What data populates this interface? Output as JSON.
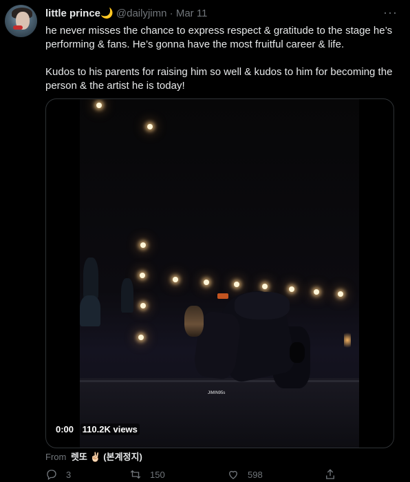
{
  "tweet": {
    "display_name": "little prince",
    "name_emoji": "🌙",
    "handle": "@dailyjimn",
    "separator": "·",
    "date": "Mar 11",
    "more_icon": "more-horizontal-icon",
    "paragraphs": [
      "he never misses the chance to express respect & gratitude to the stage he’s performing & fans. He’s gonna have the most fruitful career & life.",
      "Kudos to his parents for raising him so well & kudos to him for becoming the person & the artist he is today!"
    ],
    "video": {
      "time": "0:00",
      "views": "110.2K views",
      "watermark": "JIMIN95s"
    },
    "source": {
      "from_label": "From",
      "source_name": "렛또 ✌🏻 (본계정지)"
    },
    "actions": {
      "reply_count": "3",
      "retweet_count": "150",
      "like_count": "598"
    }
  },
  "colors": {
    "background": "#000000",
    "text": "#e7e9ea",
    "secondary": "#71767b",
    "border": "#2f3336"
  }
}
